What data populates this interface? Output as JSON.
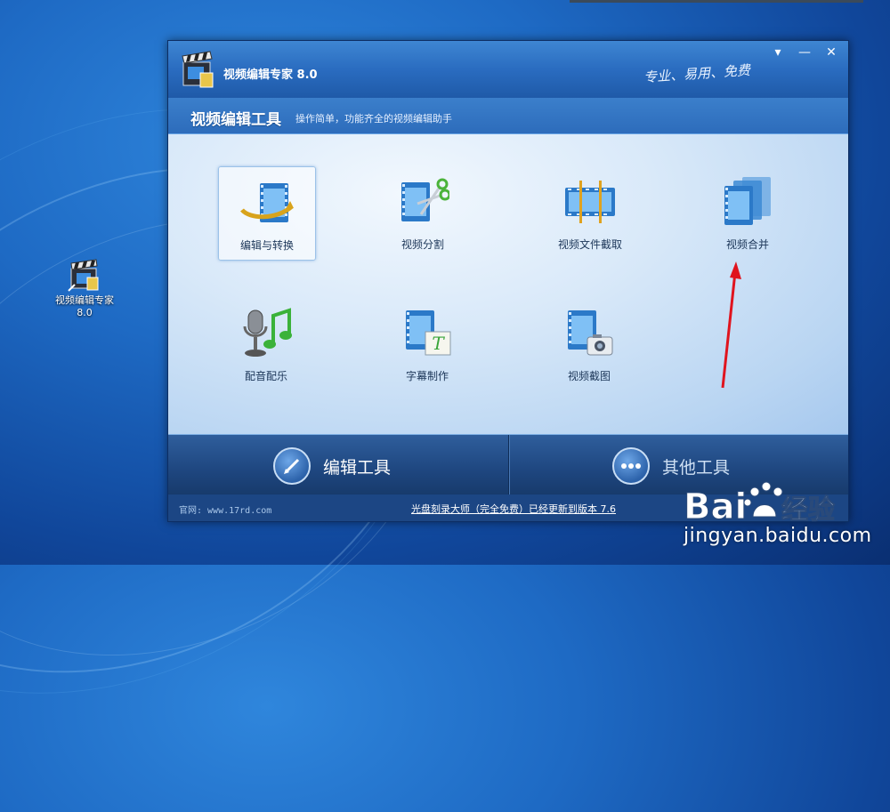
{
  "desktop": {
    "shortcut_label": "视频编辑专家 8.0"
  },
  "window": {
    "title": "视频编辑专家 8.0",
    "slogan": "专业、易用、免费",
    "controls": {
      "menu": "▾",
      "minimize": "—",
      "close": "✕"
    }
  },
  "subheader": {
    "title": "视频编辑工具",
    "description": "操作简单，功能齐全的视频编辑助手"
  },
  "tools": [
    {
      "label": "编辑与转换",
      "icon": "film-edit-convert-icon",
      "selected": true
    },
    {
      "label": "视频分割",
      "icon": "film-scissors-icon",
      "selected": false
    },
    {
      "label": "视频文件截取",
      "icon": "film-trim-icon",
      "selected": false
    },
    {
      "label": "视频合并",
      "icon": "film-merge-icon",
      "selected": false
    },
    {
      "label": "配音配乐",
      "icon": "microphone-music-icon",
      "selected": false
    },
    {
      "label": "字幕制作",
      "icon": "film-subtitle-icon",
      "selected": false
    },
    {
      "label": "视频截图",
      "icon": "film-camera-icon",
      "selected": false
    }
  ],
  "bottom_tabs": [
    {
      "label": "编辑工具",
      "icon": "pen-icon",
      "active": true
    },
    {
      "label": "其他工具",
      "icon": "more-dots-icon",
      "active": false
    }
  ],
  "footer": {
    "site": "官网: www.17rd.com",
    "update_link": "光盘刻录大师（完全免费）已经更新到版本 7.6"
  },
  "watermark": {
    "url": "jingyan.baidu.com"
  },
  "colors": {
    "accent_blue": "#2a6cc0",
    "film_blue": "#2b79c8",
    "arrow_red": "#e0141e"
  }
}
